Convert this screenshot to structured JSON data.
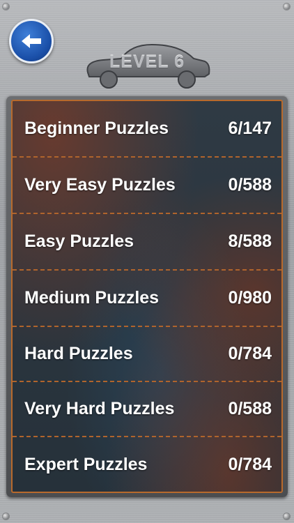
{
  "header": {
    "back_icon": "arrow-left-icon",
    "level_title": "LEVEL 6",
    "badge_icon": "car-silhouette-icon"
  },
  "categories": [
    {
      "label": "Beginner Puzzles",
      "progress": "6/147"
    },
    {
      "label": "Very Easy Puzzles",
      "progress": "0/588"
    },
    {
      "label": "Easy Puzzles",
      "progress": "8/588"
    },
    {
      "label": "Medium Puzzles",
      "progress": "0/980"
    },
    {
      "label": "Hard Puzzles",
      "progress": "0/784"
    },
    {
      "label": "Very Hard Puzzles",
      "progress": "0/588"
    },
    {
      "label": "Expert Puzzles",
      "progress": "0/784"
    }
  ],
  "colors": {
    "back_button": "#1a4fa8",
    "panel_border": "#b86a2c",
    "row_text": "#ffffff"
  }
}
